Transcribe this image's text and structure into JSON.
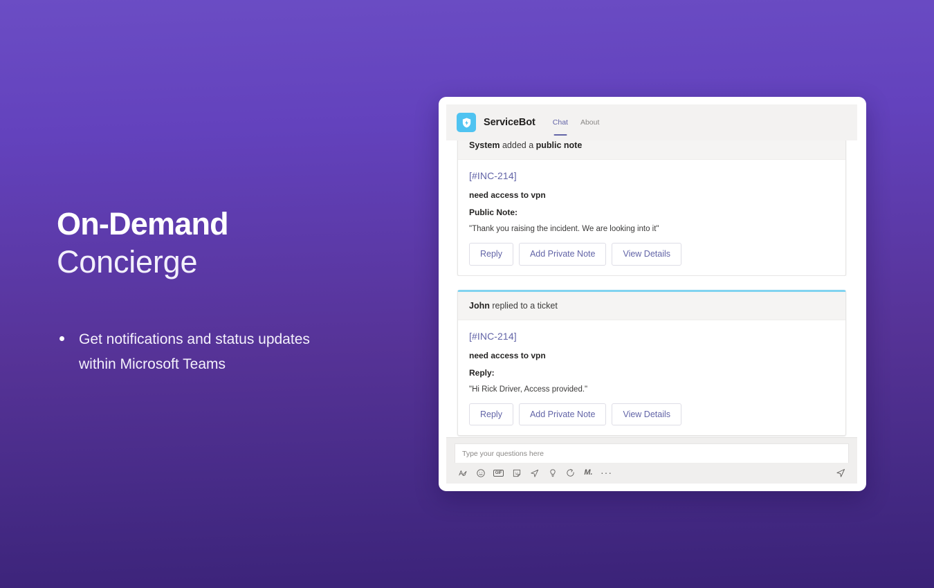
{
  "hero": {
    "headline_bold": "On-Demand",
    "headline_light": "Concierge",
    "bullets": [
      "Get notifications and status updates within Microsoft Teams"
    ]
  },
  "app": {
    "bot_name": "ServiceBot",
    "bot_icon": "shield-bolt-icon",
    "accent_color": "#6264a7",
    "bot_avatar_color": "#4fc3f1",
    "tabs": [
      {
        "label": "Chat",
        "active": true
      },
      {
        "label": "About",
        "active": false
      }
    ]
  },
  "messages": [
    {
      "header_actor": "System",
      "header_text": " added a ",
      "header_emphasis": "public note",
      "ticket_id": "[#INC-214]",
      "subject": "need access to vpn",
      "note_label": "Public Note:",
      "note_text": "\"Thank you raising the incident. We are looking into it\"",
      "buttons": [
        "Reply",
        "Add Private Note",
        "View Details"
      ]
    },
    {
      "header_actor": "John",
      "header_text": " replied to a ticket",
      "header_emphasis": "",
      "ticket_id": "[#INC-214]",
      "subject": "need access to vpn",
      "note_label": "Reply:",
      "note_text": "\"Hi Rick Driver, Access provided.\"",
      "buttons": [
        "Reply",
        "Add Private Note",
        "View Details"
      ]
    }
  ],
  "compose": {
    "placeholder": "Type your questions here",
    "value": "",
    "tools": [
      "format-text-icon",
      "emoji-icon",
      "gif-icon",
      "sticker-icon",
      "send-meeting-icon",
      "lightbulb-icon",
      "loop-icon",
      "praise-icon",
      "more-options-icon"
    ],
    "send_icon": "send-icon"
  }
}
